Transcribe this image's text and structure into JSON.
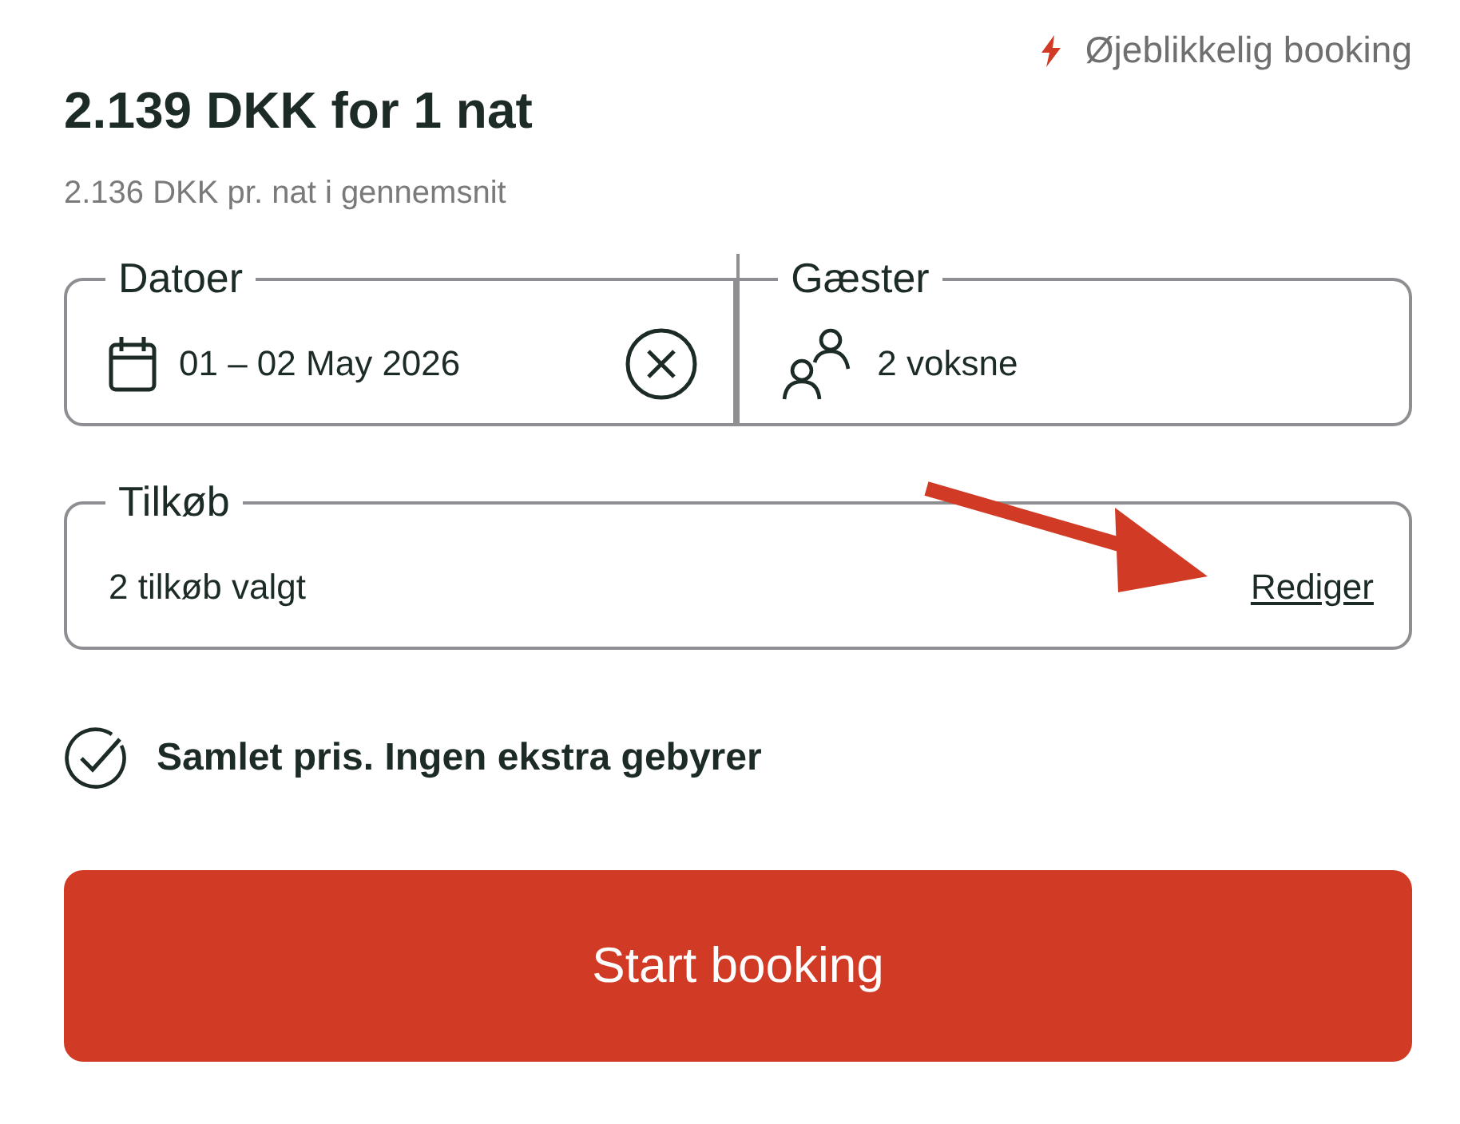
{
  "instant_booking": {
    "label": "Øjeblikkelig booking"
  },
  "price": {
    "title": "2.139 DKK for 1 nat",
    "subtitle": "2.136 DKK pr. nat i gennemsnit"
  },
  "dates": {
    "legend": "Datoer",
    "value": "01 – 02 May 2026"
  },
  "guests": {
    "legend": "Gæster",
    "value": "2 voksne"
  },
  "addons": {
    "legend": "Tilkøb",
    "value": "2 tilkøb valgt",
    "action": "Rediger"
  },
  "total_note": "Samlet pris. Ingen ekstra gebyrer",
  "primary_button": "Start booking"
}
